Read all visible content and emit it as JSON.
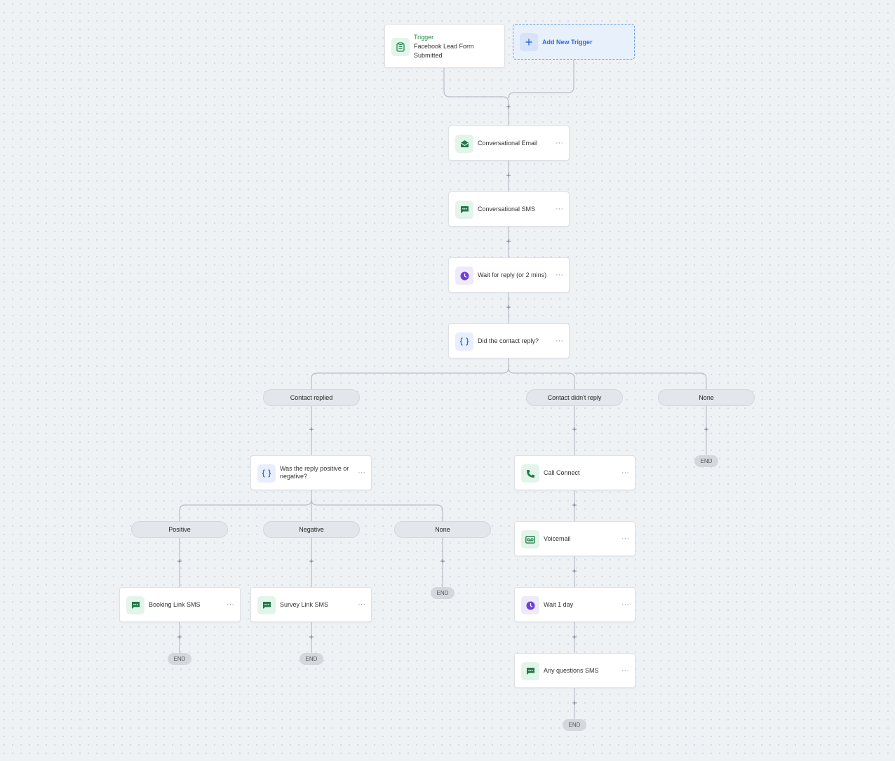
{
  "trigger": {
    "title": "Trigger",
    "subtitle": "Facebook Lead Form Submitted",
    "icon": "clipboard-icon"
  },
  "add_trigger": {
    "label": "Add New Trigger",
    "icon": "plus-icon"
  },
  "steps": {
    "conversational_email": "Conversational Email",
    "conversational_sms": "Conversational SMS",
    "wait_reply": "Wait for reply (or 2 mins)",
    "did_reply": "Did the contact reply?",
    "reply_sentiment": "Was the reply positive or negative?",
    "booking_sms": "Booking Link SMS",
    "survey_sms": "Survey Link SMS",
    "call_connect": "Call Connect",
    "voicemail": "Voicemail",
    "wait_day": "Wait 1 day",
    "questions_sms": "Any questions SMS"
  },
  "branches": {
    "contact_replied": "Contact replied",
    "contact_no_reply": "Contact didn't reply",
    "none_top": "None",
    "positive": "Positive",
    "negative": "Negative",
    "none_sub": "None"
  },
  "end_label": "END",
  "menu_glyph": "···",
  "plus_glyph": "+",
  "colors": {
    "accent_green": "#1f8a4c",
    "accent_blue": "#2e6be0",
    "accent_purple": "#6f3ed8",
    "canvas_bg": "#eff2f5"
  }
}
